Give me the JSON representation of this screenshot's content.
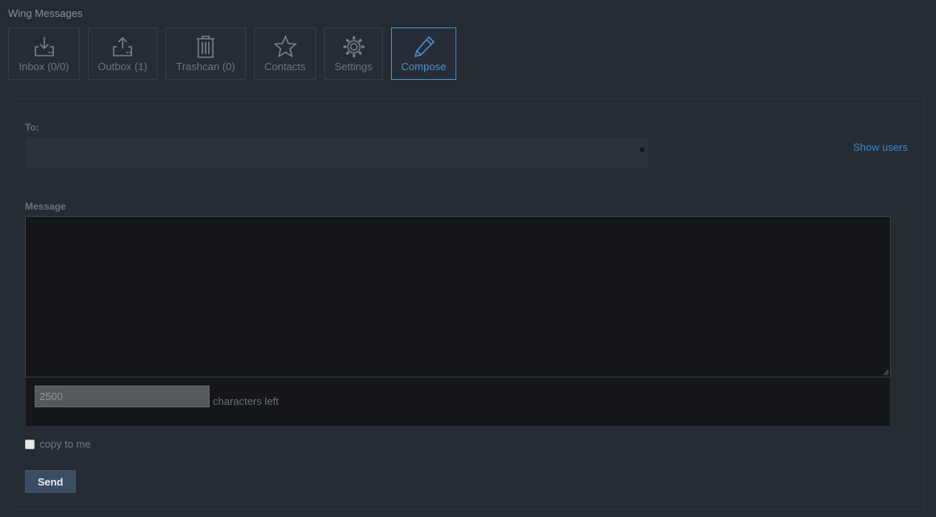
{
  "app": {
    "title": "Wing Messages"
  },
  "tabs": [
    {
      "label": "Inbox (0/0)",
      "icon": "inbox-download-icon",
      "active": false
    },
    {
      "label": "Outbox (1)",
      "icon": "outbox-upload-icon",
      "active": false
    },
    {
      "label": "Trashcan (0)",
      "icon": "trash-icon",
      "active": false
    },
    {
      "label": "Contacts",
      "icon": "star-icon",
      "active": false
    },
    {
      "label": "Settings",
      "icon": "gear-icon",
      "active": false
    },
    {
      "label": "Compose",
      "icon": "pencil-icon",
      "active": true
    }
  ],
  "compose": {
    "to_label": "To:",
    "to_value": "",
    "required_marker": "*",
    "show_users_label": "Show users",
    "message_label": "Message",
    "message_value": "",
    "chars_left_value": "2500",
    "chars_left_text": "characters left",
    "copy_to_me_label": "copy to me",
    "copy_to_me_checked": false,
    "send_label": "Send"
  },
  "colors": {
    "background": "#252b33",
    "accent": "#4a90c8",
    "link": "#3d86c6",
    "send_button": "#3b4d63"
  }
}
